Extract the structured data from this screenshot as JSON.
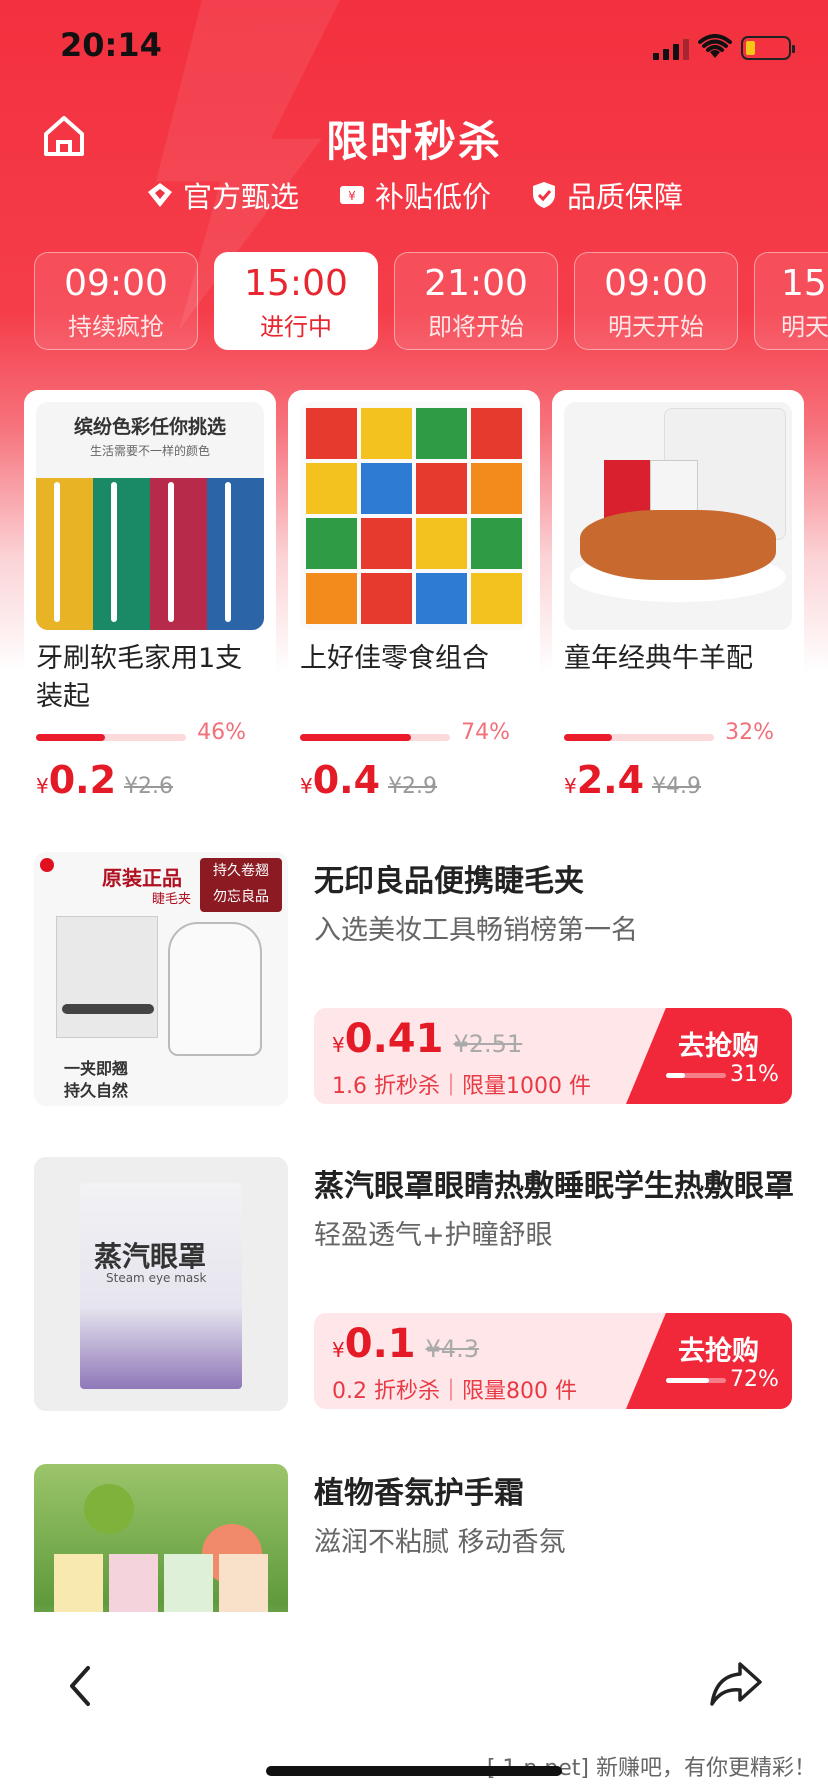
{
  "status": {
    "time": "20:14"
  },
  "header": {
    "title": "限时秒杀",
    "badges": [
      "官方甄选",
      "补贴低价",
      "品质保障"
    ]
  },
  "timeslots": [
    {
      "time": "09:00",
      "status": "持续疯抢",
      "active": false
    },
    {
      "time": "15:00",
      "status": "进行中",
      "active": true
    },
    {
      "time": "21:00",
      "status": "即将开始",
      "active": false
    },
    {
      "time": "09:00",
      "status": "明天开始",
      "active": false
    },
    {
      "time": "15",
      "status": "明天",
      "active": false
    }
  ],
  "featured": [
    {
      "name": "牙刷软毛家用1支装起",
      "progress": 46,
      "progress_label": "46%",
      "currency": "¥",
      "price": "0.2",
      "original": "¥2.6",
      "image_texts": {
        "headline": "缤纷色彩任你挑选",
        "subline": "生活需要不一样的颜色"
      }
    },
    {
      "name": "上好佳零食组合",
      "progress": 74,
      "progress_label": "74%",
      "currency": "¥",
      "price": "0.4",
      "original": "¥2.9"
    },
    {
      "name": "童年经典牛羊配",
      "progress": 32,
      "progress_label": "32%",
      "currency": "¥",
      "price": "2.4",
      "original": "¥4.9"
    }
  ],
  "list": [
    {
      "title": "无印良品便携睫毛夹",
      "subtitle": "入选美妆工具畅销榜第一名",
      "currency": "¥",
      "price": "0.41",
      "original": "¥2.51",
      "meta": "1.6 折秒杀｜限量1000 件",
      "cta": "去抢购",
      "progress": 31,
      "progress_label": "31%",
      "image_texts": {
        "main": "原装正品",
        "sub": "睫毛夹",
        "tag1": "持久卷翘",
        "tag2": "勿忘良品",
        "bottom1": "一夹即翘",
        "bottom2": "持久自然"
      }
    },
    {
      "title": "蒸汽眼罩眼睛热敷睡眠学生热敷眼罩",
      "subtitle": "轻盈透气+护瞳舒眼",
      "currency": "¥",
      "price": "0.1",
      "original": "¥4.3",
      "meta": "0.2 折秒杀｜限量800 件",
      "cta": "去抢购",
      "progress": 72,
      "progress_label": "72%",
      "image_texts": {
        "main": "蒸汽眼罩",
        "en": "Steam eye mask"
      }
    },
    {
      "title": "植物香氛护手霜",
      "subtitle": "滋润不粘腻 移动香氛"
    }
  ],
  "watermark": "[ 1 n.net] 新赚吧，有你更精彩！",
  "colors": {
    "brand_red": "#f3303f",
    "price_red": "#e41b26",
    "progress_track": "#fcd9db"
  }
}
